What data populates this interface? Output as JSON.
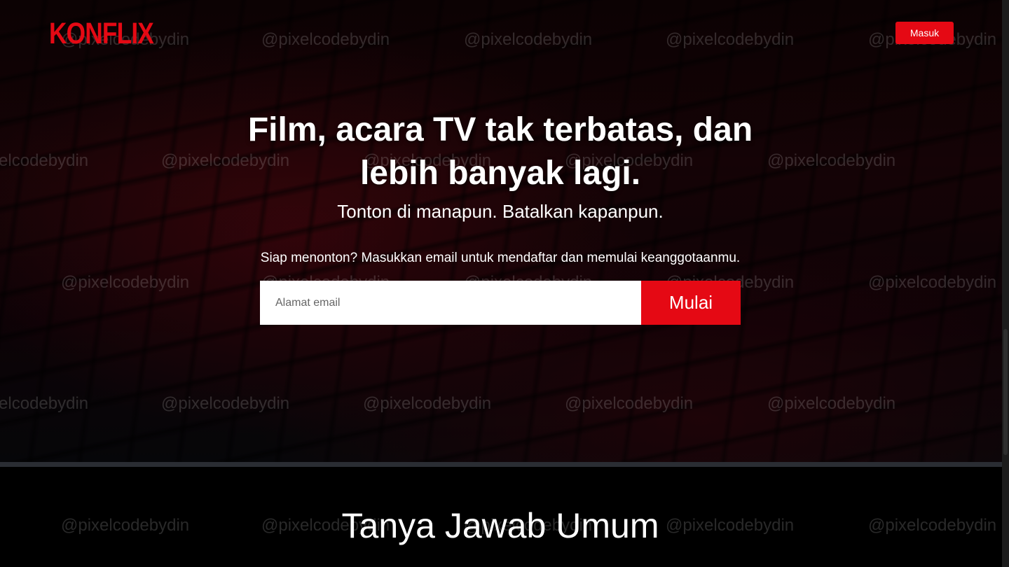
{
  "header": {
    "logo": "KONFLIX",
    "signin_label": "Masuk"
  },
  "hero": {
    "title": "Film, acara TV tak terbatas, dan lebih banyak lagi.",
    "subtitle": "Tonton di manapun. Batalkan kapanpun.",
    "cta_text": "Siap menonton? Masukkan email untuk mendaftar dan memulai keanggotaanmu.",
    "email_placeholder": "Alamat email",
    "start_label": "Mulai"
  },
  "faq": {
    "title": "Tanya Jawab Umum"
  },
  "watermark": {
    "text": "@pixelcodebydin"
  },
  "colors": {
    "brand_red": "#e50914",
    "background": "#000000",
    "divider": "#2a2d33"
  },
  "icons": {
    "logo": "konflix-wordmark"
  }
}
